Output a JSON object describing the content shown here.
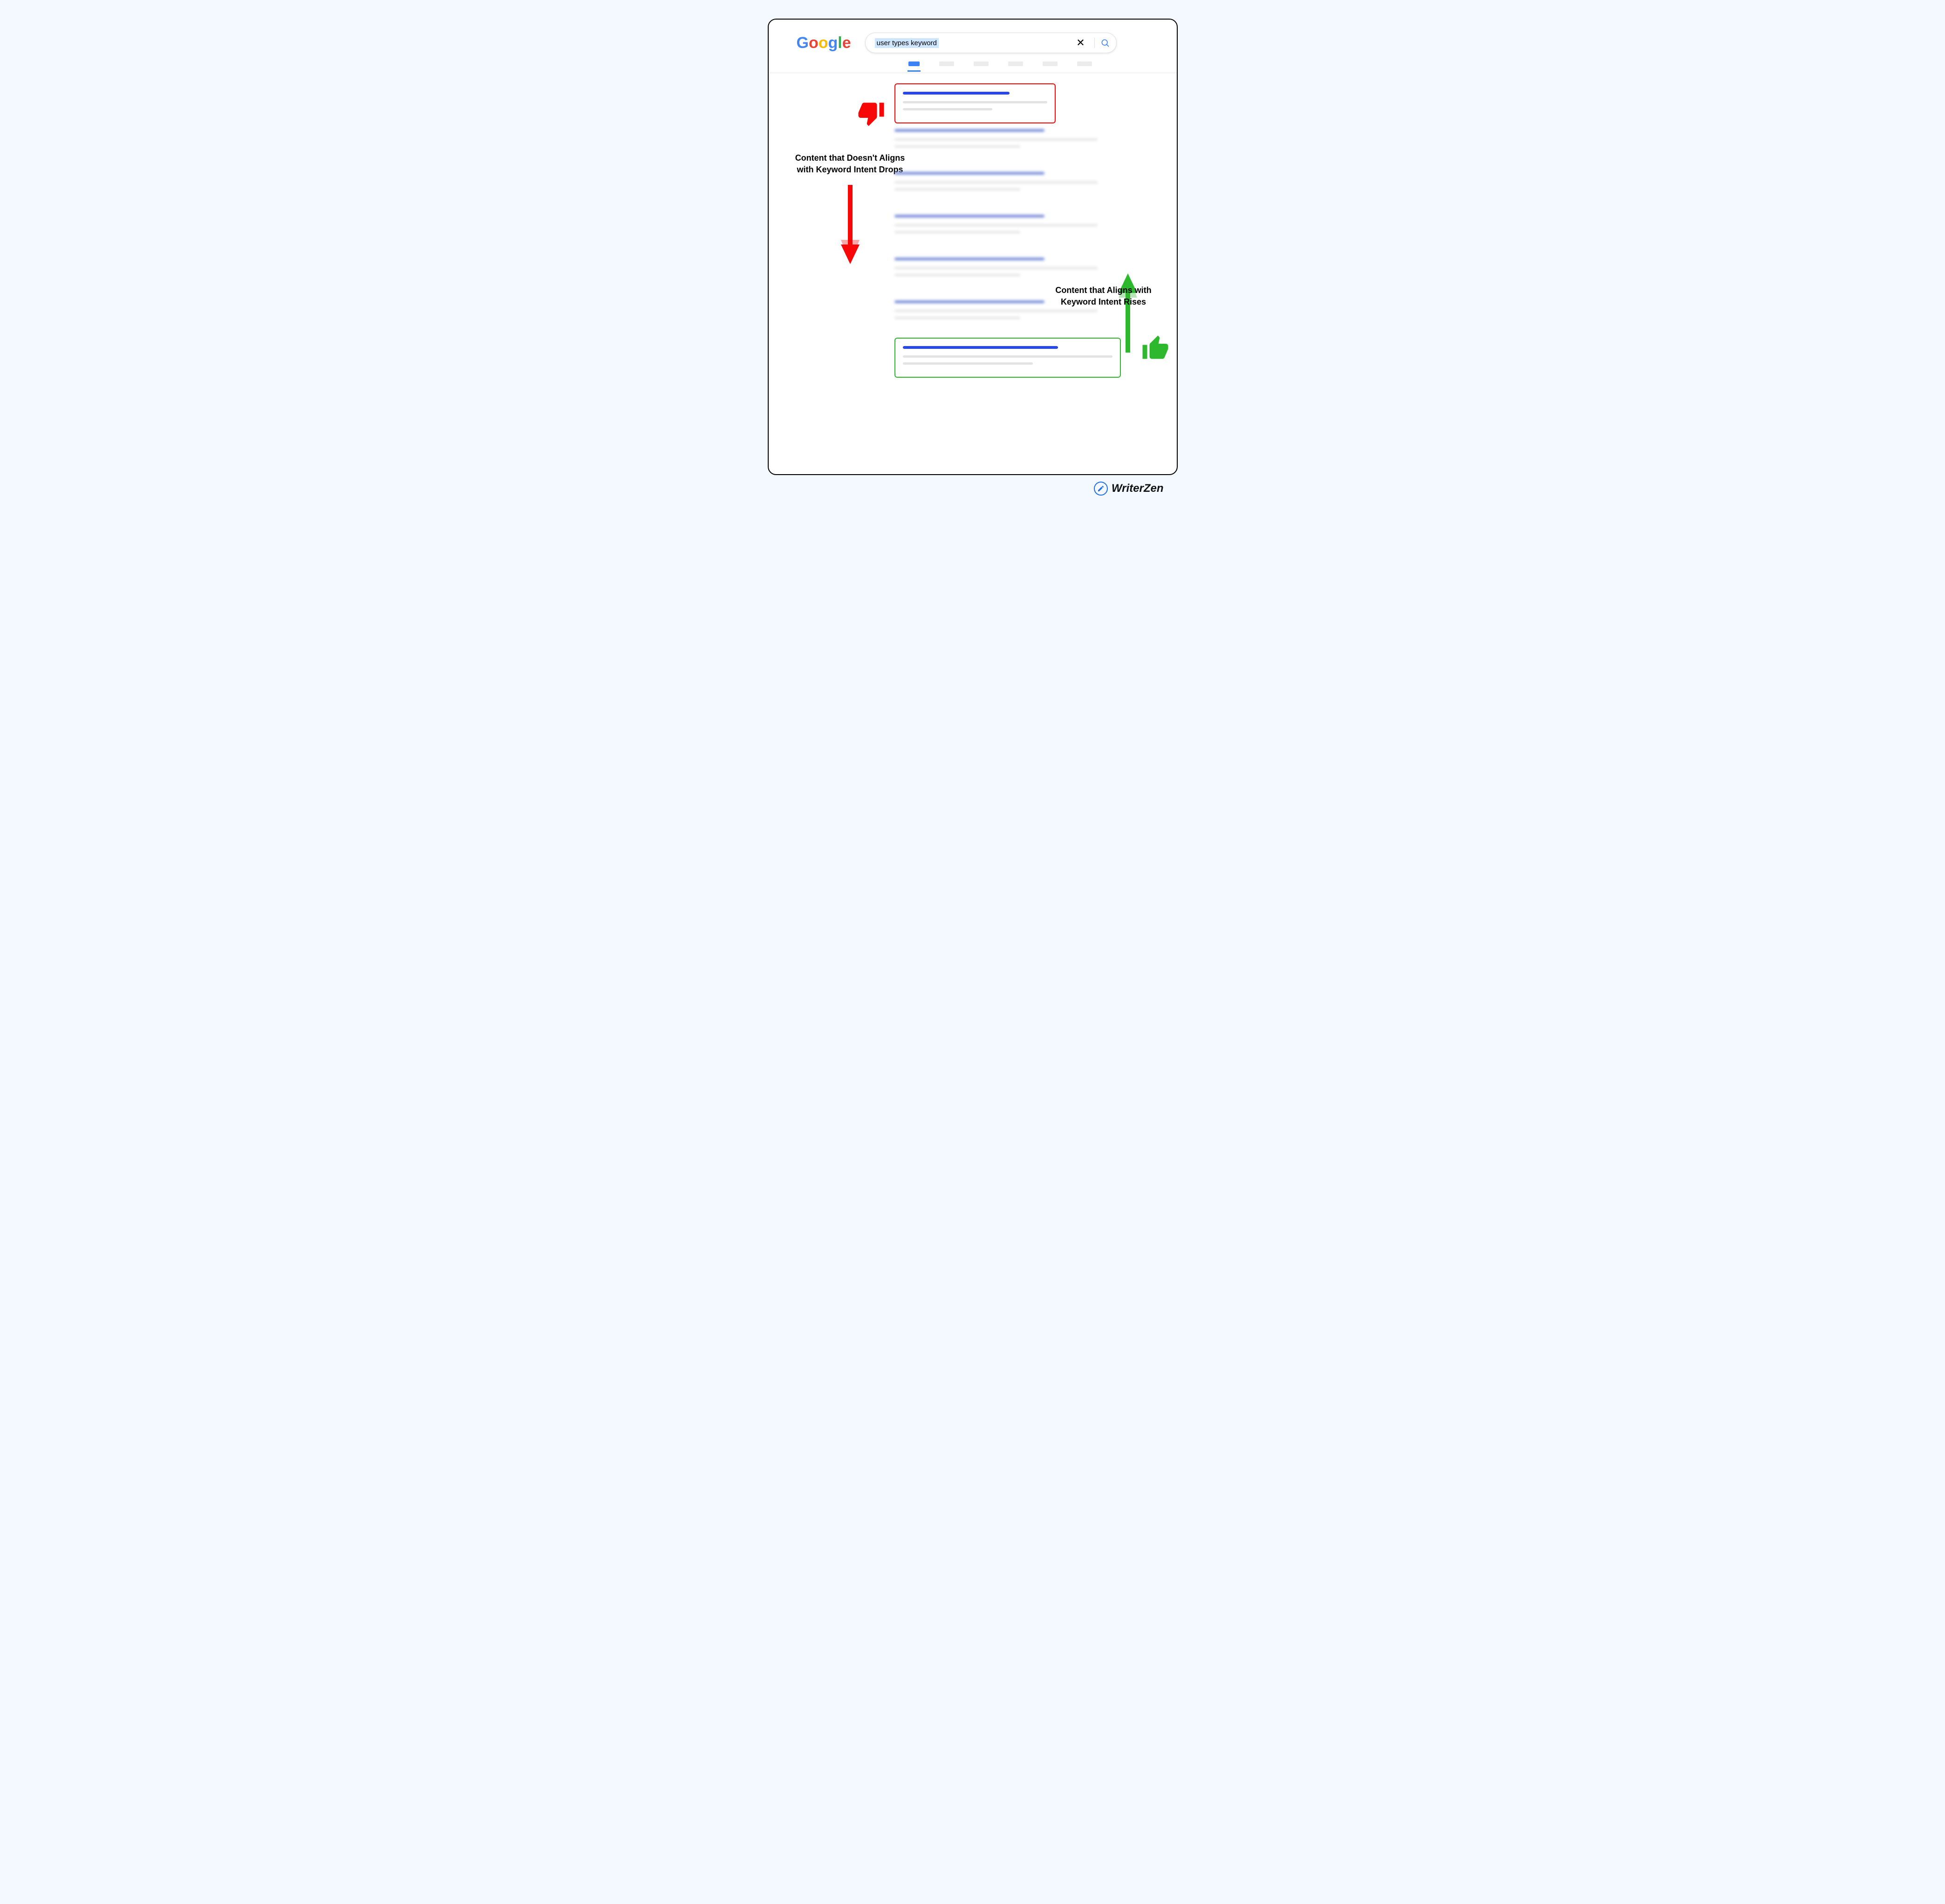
{
  "logo": {
    "letters": [
      "G",
      "o",
      "o",
      "g",
      "l",
      "e"
    ]
  },
  "search": {
    "query": "user types keyword"
  },
  "labels": {
    "drops": "Content that Doesn't Aligns with Keyword Intent Drops",
    "rises": "Content that Aligns with Keyword Intent Rises"
  },
  "brand": {
    "name": "WriterZen"
  },
  "colors": {
    "red": "#f70707",
    "green": "#2eb82e",
    "blue": "#2947ef"
  }
}
